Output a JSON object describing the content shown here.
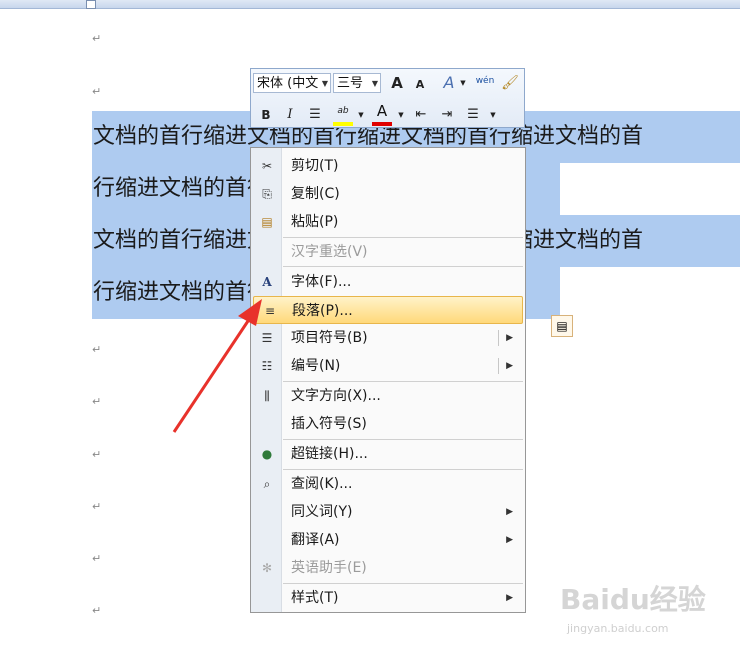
{
  "document": {
    "lines": [
      "文档的首行缩进文档的首行缩进文档的首行缩进文档的首",
      "行缩进文档的首行缩进文档的首行缩进",
      "文档的首行缩进文档的首行缩进文档的首行缩进文档的首",
      "行缩进文档的首行缩进文档的首行缩进"
    ],
    "paragraph_mark": "↵"
  },
  "mini_toolbar": {
    "font_name": "宋体 (中文",
    "font_size": "三号",
    "buttons": {
      "grow": "A",
      "shrink": "A",
      "styles": "A",
      "phonetic": "wén",
      "bold": "B",
      "italic": "I",
      "highlight": "ab",
      "font_color": "A"
    },
    "highlight_color": "#ffff00",
    "font_color": "#e00000"
  },
  "context_menu": {
    "items": [
      {
        "label": "剪切(T)",
        "icon": "scissors-icon",
        "glyph": "✂"
      },
      {
        "label": "复制(C)",
        "icon": "copy-icon",
        "glyph": "⎘"
      },
      {
        "label": "粘贴(P)",
        "icon": "paste-icon",
        "glyph": "📋"
      },
      {
        "label": "汉字重选(V)",
        "disabled": true
      },
      {
        "label": "字体(F)...",
        "icon": "font-icon",
        "glyph": "A"
      },
      {
        "label": "段落(P)...",
        "icon": "paragraph-icon",
        "glyph": "≡",
        "highlighted": true
      },
      {
        "label": "项目符号(B)",
        "icon": "bullets-icon",
        "glyph": "☰",
        "submenu": true
      },
      {
        "label": "编号(N)",
        "icon": "numbering-icon",
        "glyph": "☰",
        "submenu": true
      },
      {
        "label": "文字方向(X)...",
        "icon": "text-direction-icon",
        "glyph": "⫼"
      },
      {
        "label": "插入符号(S)"
      },
      {
        "label": "超链接(H)...",
        "icon": "hyperlink-icon",
        "glyph": "🌐"
      },
      {
        "label": "查阅(K)...",
        "icon": "research-icon",
        "glyph": "🔍"
      },
      {
        "label": "同义词(Y)",
        "submenu_arrow": true
      },
      {
        "label": "翻译(A)",
        "submenu_arrow": true
      },
      {
        "label": "英语助手(E)",
        "icon": "english-assistant-icon",
        "glyph": "✻",
        "disabled": true
      },
      {
        "label": "样式(T)",
        "submenu_arrow": true
      }
    ]
  },
  "watermark": {
    "text": "Baidu经验",
    "sub": "jingyan.baidu.com"
  },
  "accent": {
    "selection": "#aecbf0",
    "highlight_border": "#e8b64b",
    "arrow": "#e8322b"
  }
}
